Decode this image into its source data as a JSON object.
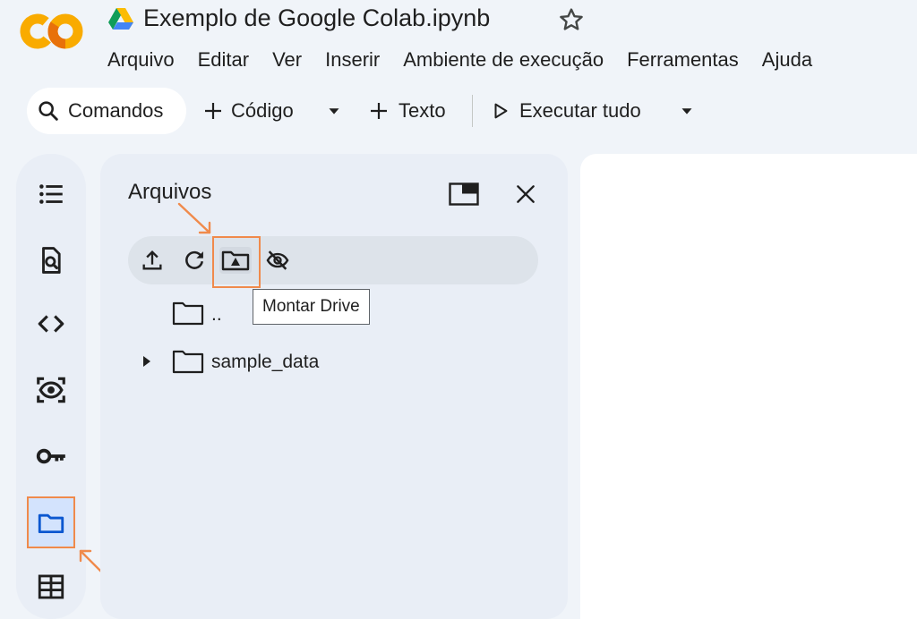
{
  "header": {
    "title": "Exemplo de Google Colab.ipynb",
    "menu": [
      "Arquivo",
      "Editar",
      "Ver",
      "Inserir",
      "Ambiente de execução",
      "Ferramentas",
      "Ajuda"
    ]
  },
  "toolbar": {
    "commands_label": "Comandos",
    "add_code_label": "Código",
    "add_text_label": "Texto",
    "run_all_label": "Executar tudo"
  },
  "files_panel": {
    "title": "Arquivos",
    "tooltip": "Montar Drive",
    "items": [
      {
        "name": "..",
        "expandable": false
      },
      {
        "name": "sample_data",
        "expandable": true
      }
    ]
  },
  "colors": {
    "logo_orange": "#f9ab00",
    "logo_dark_orange": "#e8710a",
    "annotation": "#f08a4b",
    "active_rail": "#d3e3fd"
  },
  "icons": {
    "rail": [
      "table-of-contents-icon",
      "find-icon",
      "code-snippets-icon",
      "variables-icon",
      "secrets-key-icon",
      "files-folder-icon",
      "table-icon"
    ],
    "files_toolbar": [
      "upload-icon",
      "refresh-icon",
      "mount-drive-icon",
      "hide-icon"
    ]
  }
}
